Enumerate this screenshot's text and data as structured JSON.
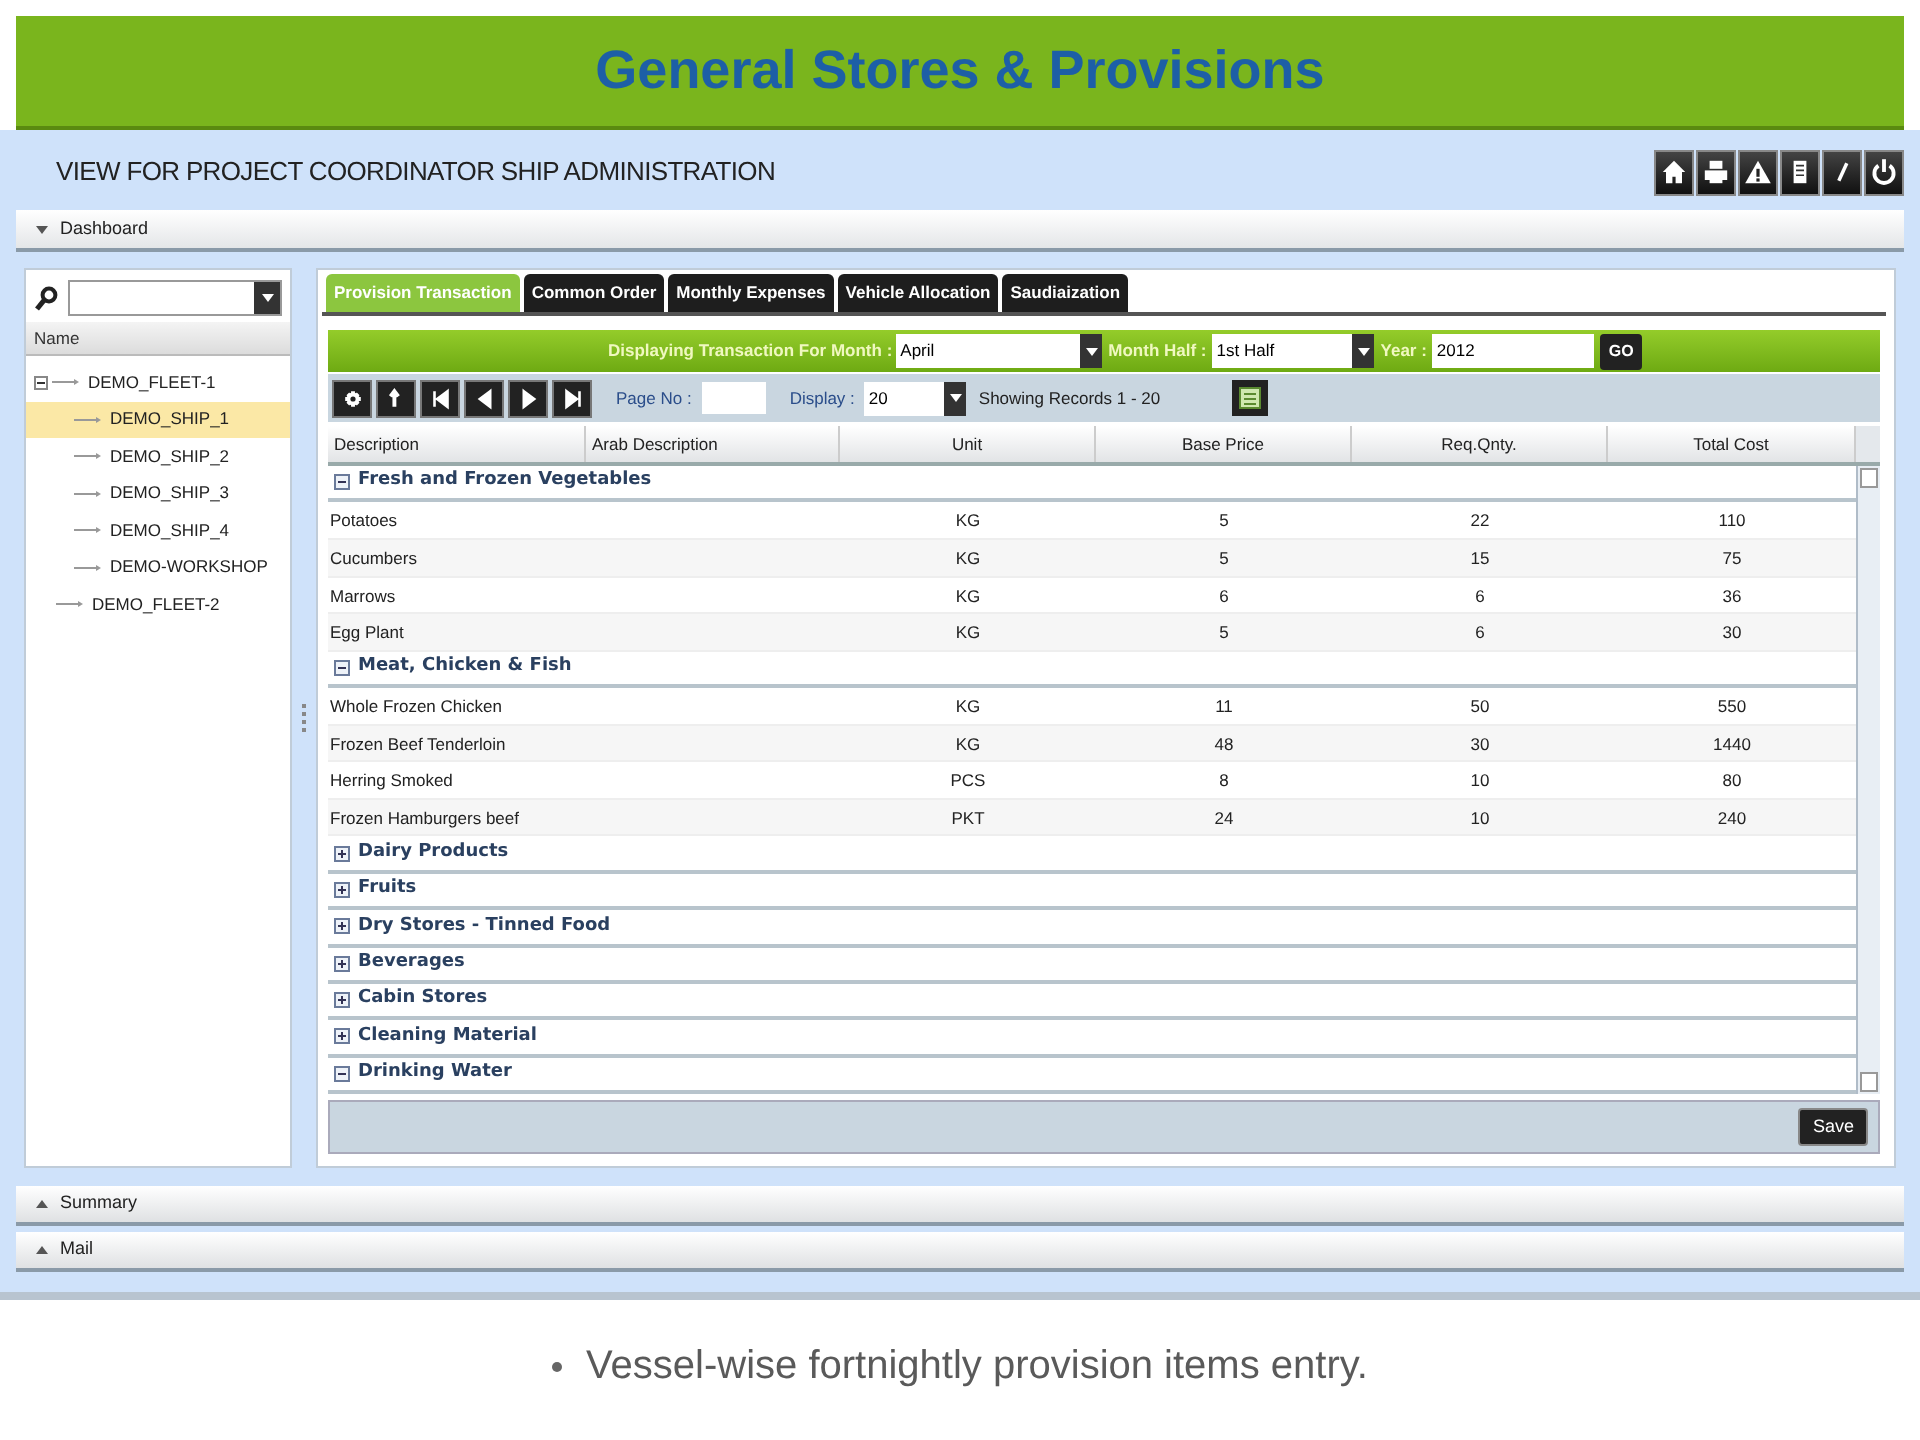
{
  "slide_title": "General Stores & Provisions",
  "view_title": "VIEW FOR PROJECT COORDINATOR SHIP ADMINISTRATION",
  "toolbar_icons": [
    {
      "kind": "home"
    },
    {
      "kind": "print"
    },
    {
      "kind": "warning"
    },
    {
      "kind": "document"
    },
    {
      "kind": "edit"
    },
    {
      "kind": "power"
    }
  ],
  "dashboard": {
    "label": "Dashboard",
    "expanded": true
  },
  "tree": {
    "column": "Name",
    "items": [
      {
        "label": "DEMO_FLEET-1",
        "selected": false,
        "expanded": true,
        "children": [
          {
            "label": "DEMO_SHIP_1",
            "selected": true
          },
          {
            "label": "DEMO_SHIP_2",
            "selected": false
          },
          {
            "label": "DEMO_SHIP_3",
            "selected": false
          },
          {
            "label": "DEMO_SHIP_4",
            "selected": false
          },
          {
            "label": "DEMO-WORKSHOP",
            "selected": false
          }
        ]
      },
      {
        "label": "DEMO_FLEET-2",
        "selected": false
      }
    ]
  },
  "tabs": [
    {
      "label": "Provision Transaction",
      "selected": true
    },
    {
      "label": "Common Order",
      "selected": false
    },
    {
      "label": "Monthly Expenses",
      "selected": false
    },
    {
      "label": "Vehicle Allocation",
      "selected": false
    },
    {
      "label": "Saudiaization",
      "selected": false
    }
  ],
  "filter": {
    "month_label": "Displaying Transaction For Month :",
    "month": "April",
    "half_label": "Month Half :",
    "half": "1st Half",
    "year_label": "Year :",
    "year": "2012",
    "go": "GO"
  },
  "pager": {
    "page_label": "Page No :",
    "display_label": "Display :",
    "display": "20",
    "records": "Showing Records 1 - 20"
  },
  "table": {
    "columns": [
      "Description",
      "Arab Description",
      "Unit",
      "Base Price",
      "Req.Qnty.",
      "Total Cost"
    ],
    "groups": [
      {
        "name": "Fresh and Frozen Vegetables",
        "expanded": true,
        "rows": [
          [
            "Potatoes",
            "",
            "KG",
            "5",
            "22",
            "110"
          ],
          [
            "Cucumbers",
            "",
            "KG",
            "5",
            "15",
            "75"
          ],
          [
            "Marrows",
            "",
            "KG",
            "6",
            "6",
            "36"
          ],
          [
            "Egg Plant",
            "",
            "KG",
            "5",
            "6",
            "30"
          ]
        ]
      },
      {
        "name": "Meat, Chicken & Fish",
        "expanded": true,
        "rows": [
          [
            "Whole Frozen Chicken",
            "",
            "KG",
            "11",
            "50",
            "550"
          ],
          [
            "Frozen Beef Tenderloin",
            "",
            "KG",
            "48",
            "30",
            "1440"
          ],
          [
            "Herring Smoked",
            "",
            "PCS",
            "8",
            "10",
            "80"
          ],
          [
            "Frozen Hamburgers beef",
            "",
            "PKT",
            "24",
            "10",
            "240"
          ]
        ]
      },
      {
        "name": "Dairy Products",
        "expanded": false
      },
      {
        "name": "Fruits",
        "expanded": false
      },
      {
        "name": "Dry Stores - Tinned Food",
        "expanded": false
      },
      {
        "name": "Beverages",
        "expanded": false
      },
      {
        "name": "Cabin Stores",
        "expanded": false
      },
      {
        "name": "Cleaning Material",
        "expanded": false
      },
      {
        "name": "Drinking Water",
        "expanded": true
      }
    ]
  },
  "save": "Save",
  "panels": [
    {
      "label": "Summary",
      "expanded": false
    },
    {
      "label": "Mail",
      "expanded": false
    }
  ],
  "bullet": "Vessel-wise fortnightly provision items entry."
}
